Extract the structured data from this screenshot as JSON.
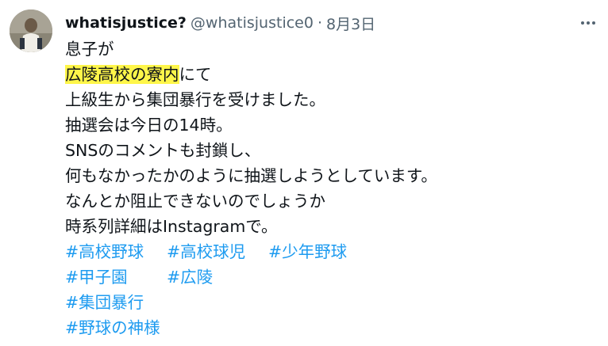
{
  "author": {
    "name": "whatisjustice?",
    "handle": "@whatisjustice0",
    "separator": "·",
    "date": "8月3日"
  },
  "tweet": {
    "line1": "息子が",
    "line2_highlight": "広陵高校の寮内",
    "line2_rest": "にて",
    "line3": "上級生から集団暴行を受けました。",
    "line4": "抽選会は今日の14時。",
    "line5": "SNSのコメントも封鎖し、",
    "line6": "何もなかったかのように抽選しようとしています。",
    "line7": "なんとか阻止できないのでしょうか",
    "line8": "時系列詳細はInstagramで。",
    "hashtags": [
      "#高校野球",
      "#高校球児",
      "#少年野球",
      "#甲子園",
      "#広陵",
      "#集団暴行",
      "#野球の神様"
    ]
  },
  "icons": {
    "avatar": "player-avatar",
    "more": "more-icon"
  },
  "colors": {
    "hashtag": "#1d9bf0",
    "highlight": "#fff64a",
    "secondary": "#536471"
  }
}
